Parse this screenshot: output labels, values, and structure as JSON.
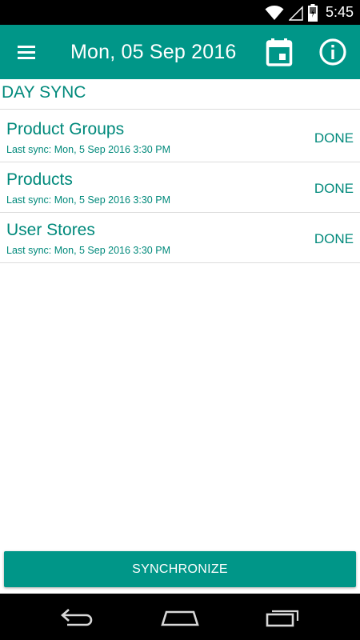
{
  "status_bar": {
    "time": "5:45",
    "icons": [
      "wifi-icon",
      "signal-icon",
      "battery-icon"
    ]
  },
  "toolbar": {
    "title": "Mon, 05 Sep 2016",
    "icons": [
      "menu-icon",
      "calendar-icon",
      "info-icon"
    ]
  },
  "section": {
    "title": "DAY SYNC"
  },
  "sync_items": [
    {
      "title": "Product Groups",
      "subtitle": "Last sync: Mon, 5 Sep 2016 3:30 PM",
      "status": "DONE"
    },
    {
      "title": "Products",
      "subtitle": "Last sync: Mon, 5 Sep 2016 3:30 PM",
      "status": "DONE"
    },
    {
      "title": "User Stores",
      "subtitle": "Last sync: Mon, 5 Sep 2016 3:30 PM",
      "status": "DONE"
    }
  ],
  "button": {
    "label": "SYNCHRONIZE"
  },
  "nav_bar": {
    "icons": [
      "back-icon",
      "home-icon",
      "recents-icon"
    ]
  },
  "colors": {
    "primary": "#009688",
    "accent_text": "#00897b",
    "status_bar": "#000000",
    "divider": "#dcdcdc"
  }
}
